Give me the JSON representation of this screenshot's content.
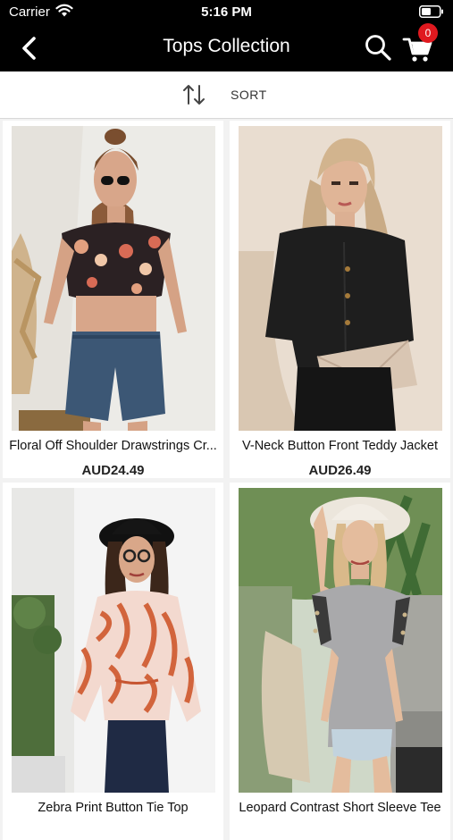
{
  "status_bar": {
    "carrier": "Carrier",
    "time": "5:16 PM"
  },
  "nav": {
    "title": "Tops Collection",
    "cart_count": "0"
  },
  "sort": {
    "label": "SORT"
  },
  "products": [
    {
      "name": "Floral Off Shoulder Drawstrings Cr...",
      "price": "AUD24.49"
    },
    {
      "name": "V-Neck Button Front Teddy Jacket",
      "price": "AUD26.49"
    },
    {
      "name": "Zebra Print Button Tie Top",
      "price": ""
    },
    {
      "name": "Leopard Contrast Short Sleeve Tee",
      "price": ""
    }
  ],
  "colors": {
    "bar": "#000000",
    "badge": "#e0191f",
    "background": "#f2f2f2"
  }
}
